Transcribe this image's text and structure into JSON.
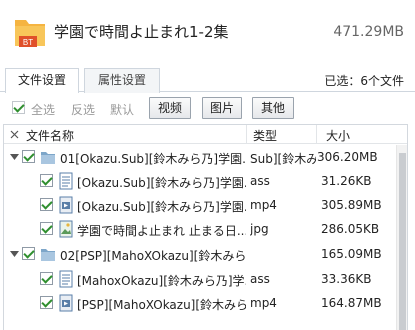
{
  "header": {
    "title": "学園で時間よ止まれ1-2集",
    "total_size": "471.29MB",
    "folder_badge": "BT"
  },
  "tabs": [
    {
      "label": "文件设置",
      "active": true
    },
    {
      "label": "属性设置",
      "active": false
    }
  ],
  "selected_count": "已选：6个文件",
  "toolbar": {
    "select_all": "全选",
    "invert": "反选",
    "default": "默认",
    "video": "视频",
    "image": "图片",
    "other": "其他"
  },
  "columns": {
    "name": "文件名称",
    "type": "类型",
    "size": "大小"
  },
  "rows": [
    {
      "name": "01[Okazu.Sub][鈴木みら乃]学園...",
      "type": "Sub][鈴木み",
      "size": "306.20MB",
      "level": 0,
      "icon": "folder-icon"
    },
    {
      "name": "[Okazu.Sub][鈴木みら乃]学園...",
      "type": "ass",
      "size": "31.26KB",
      "level": 1,
      "icon": "text-file-icon"
    },
    {
      "name": "[Okazu.Sub][鈴木みら乃]学園...",
      "type": "mp4",
      "size": "305.89MB",
      "level": 1,
      "icon": "video-file-icon"
    },
    {
      "name": "学園で時間よ止まれ 止まる日...",
      "type": "jpg",
      "size": "286.05KB",
      "level": 1,
      "icon": "image-file-icon"
    },
    {
      "name": "02[PSP][MahoXOkazu][鈴木みら...",
      "type": "",
      "size": "165.09MB",
      "level": 0,
      "icon": "folder-icon"
    },
    {
      "name": "[MahoxOkazu][鈴木みら乃]学...",
      "type": "ass",
      "size": "33.36KB",
      "level": 1,
      "icon": "text-file-icon"
    },
    {
      "name": "[PSP][MahoXOkazu][鈴木みら...",
      "type": "mp4",
      "size": "164.87MB",
      "level": 1,
      "icon": "video-file-icon"
    }
  ],
  "colors": {
    "check": "#2f8f2f",
    "border": "#cfd6de",
    "folder": "#f5b441"
  }
}
